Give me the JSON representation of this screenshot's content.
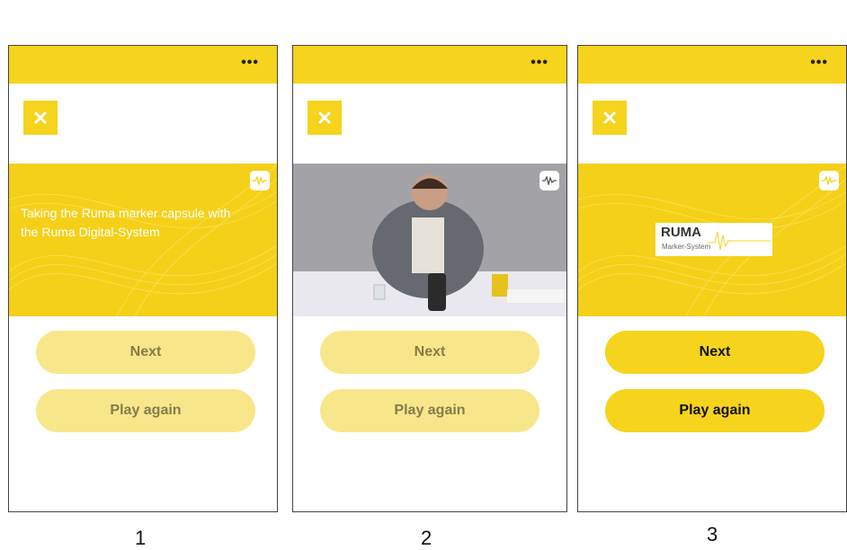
{
  "screens": [
    {
      "number": "1",
      "menu_label": "•••",
      "close_icon": "close-icon",
      "banner_text": "Taking the Ruma marker capsule with the Ruma Digital-System",
      "buttons": {
        "next": "Next",
        "play_again": "Play again"
      },
      "button_state": "disabled"
    },
    {
      "number": "2",
      "menu_label": "•••",
      "close_icon": "close-icon",
      "media": "video-frame",
      "buttons": {
        "next": "Next",
        "play_again": "Play again"
      },
      "button_state": "disabled"
    },
    {
      "number": "3",
      "menu_label": "•••",
      "close_icon": "close-icon",
      "logo": {
        "name": "RUMA",
        "sub": "Marker-System"
      },
      "buttons": {
        "next": "Next",
        "play_again": "Play again"
      },
      "button_state": "active"
    }
  ],
  "colors": {
    "accent": "#f6d31c",
    "disabled_button": "#f8e68a",
    "disabled_text": "#857b4d"
  }
}
